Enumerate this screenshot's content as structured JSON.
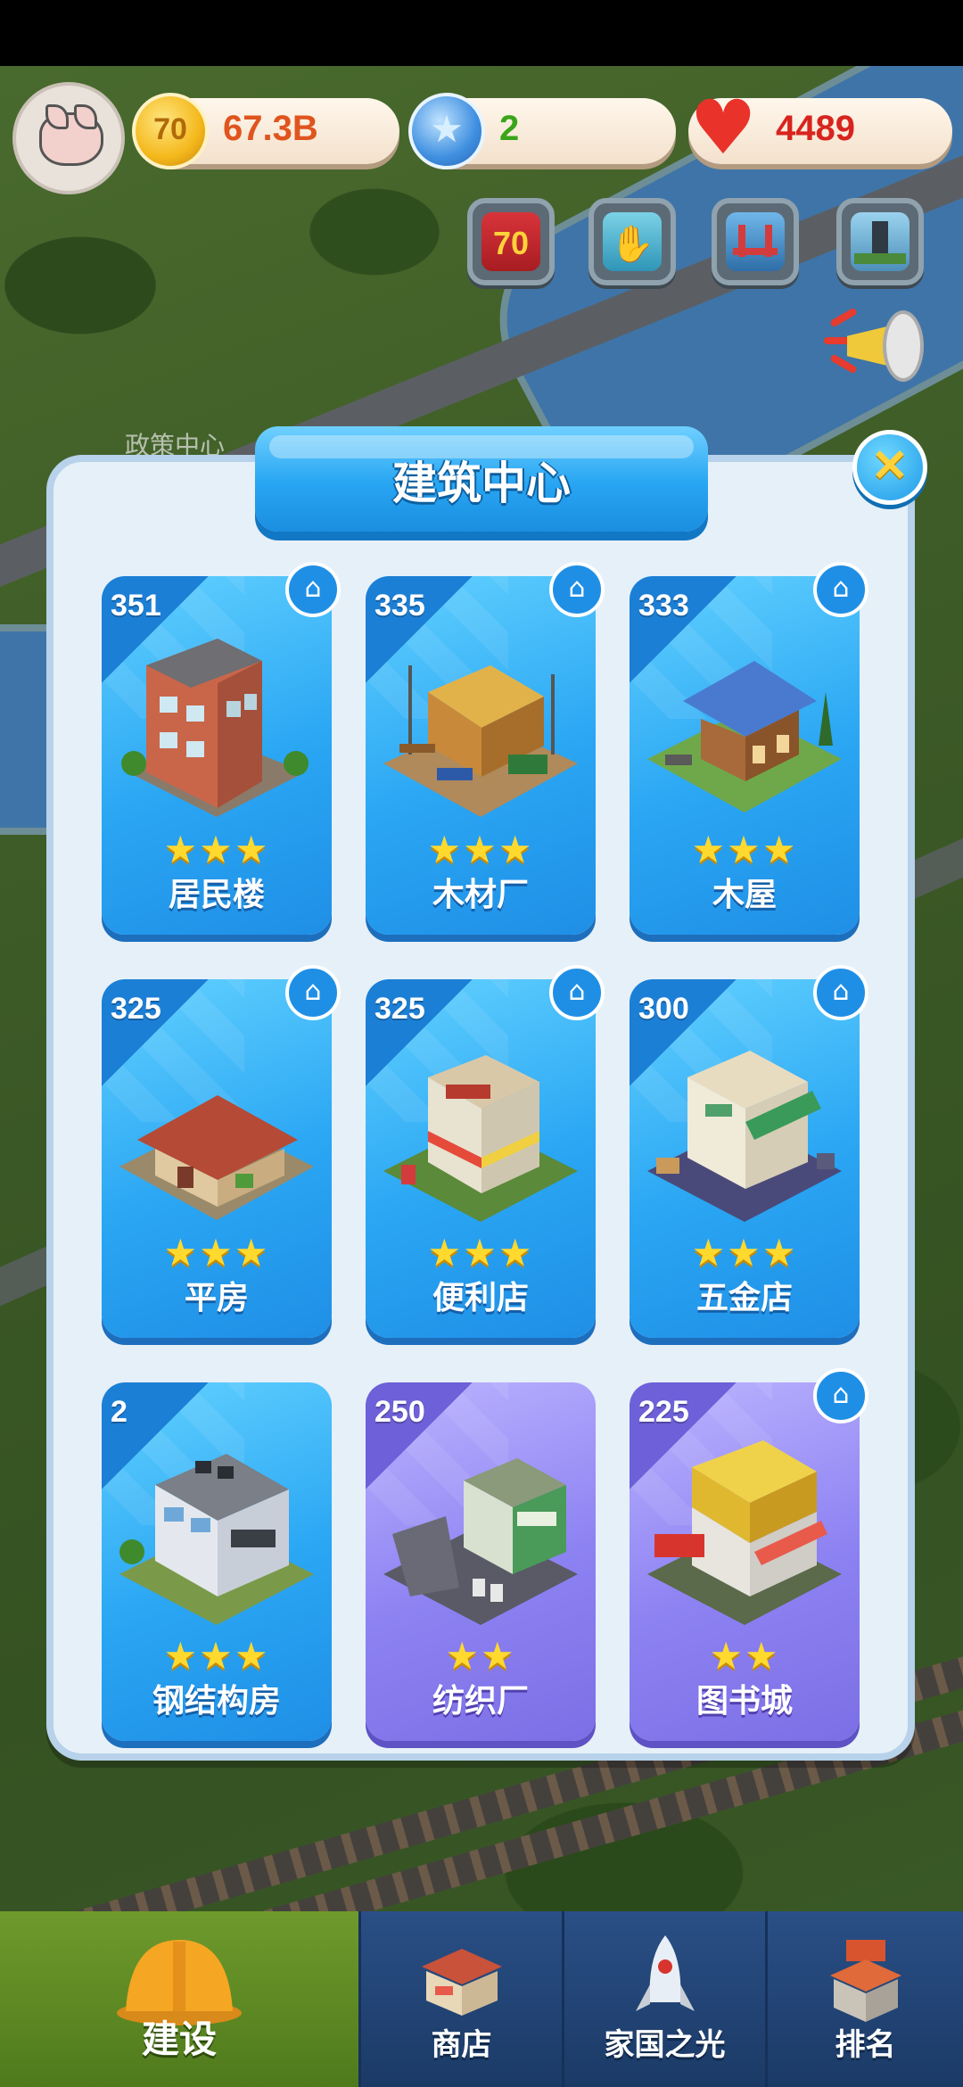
{
  "hud": {
    "coins": "67.3B",
    "coin_glyph": "70",
    "gems": "2",
    "hearts": "4489"
  },
  "event_icons": [
    "anniversary-70-icon",
    "handshake-icon",
    "bridge-icon",
    "lighthouse-icon"
  ],
  "background_label": "政策中心",
  "panel": {
    "title": "建筑中心",
    "buildings": [
      {
        "count": "351",
        "name": "居民楼",
        "stars": 3,
        "theme": "blue",
        "has_home": true
      },
      {
        "count": "335",
        "name": "木材厂",
        "stars": 3,
        "theme": "blue",
        "has_home": true
      },
      {
        "count": "333",
        "name": "木屋",
        "stars": 3,
        "theme": "blue",
        "has_home": true
      },
      {
        "count": "325",
        "name": "平房",
        "stars": 3,
        "theme": "blue",
        "has_home": true
      },
      {
        "count": "325",
        "name": "便利店",
        "stars": 3,
        "theme": "blue",
        "has_home": true
      },
      {
        "count": "300",
        "name": "五金店",
        "stars": 3,
        "theme": "blue",
        "has_home": true
      },
      {
        "count": "2",
        "name": "钢结构房",
        "stars": 3,
        "theme": "blue",
        "has_home": false
      },
      {
        "count": "250",
        "name": "纺织厂",
        "stars": 2,
        "theme": "purple",
        "has_home": false
      },
      {
        "count": "225",
        "name": "图书城",
        "stars": 2,
        "theme": "purple",
        "has_home": true
      }
    ]
  },
  "nav": [
    {
      "label": "建设",
      "icon": "hard-hat-icon",
      "active": true
    },
    {
      "label": "商店",
      "icon": "shop-icon",
      "active": false
    },
    {
      "label": "家国之光",
      "icon": "rocket-icon",
      "active": false
    },
    {
      "label": "排名",
      "icon": "ranking-building-icon",
      "active": false
    }
  ],
  "colors": {
    "card_blue": "#2aa6f3",
    "card_purple": "#8d82f2",
    "star": "#ffd92e",
    "coin_text": "#e0541e",
    "gem_text": "#3aa51a",
    "heart_text": "#d8241e"
  }
}
